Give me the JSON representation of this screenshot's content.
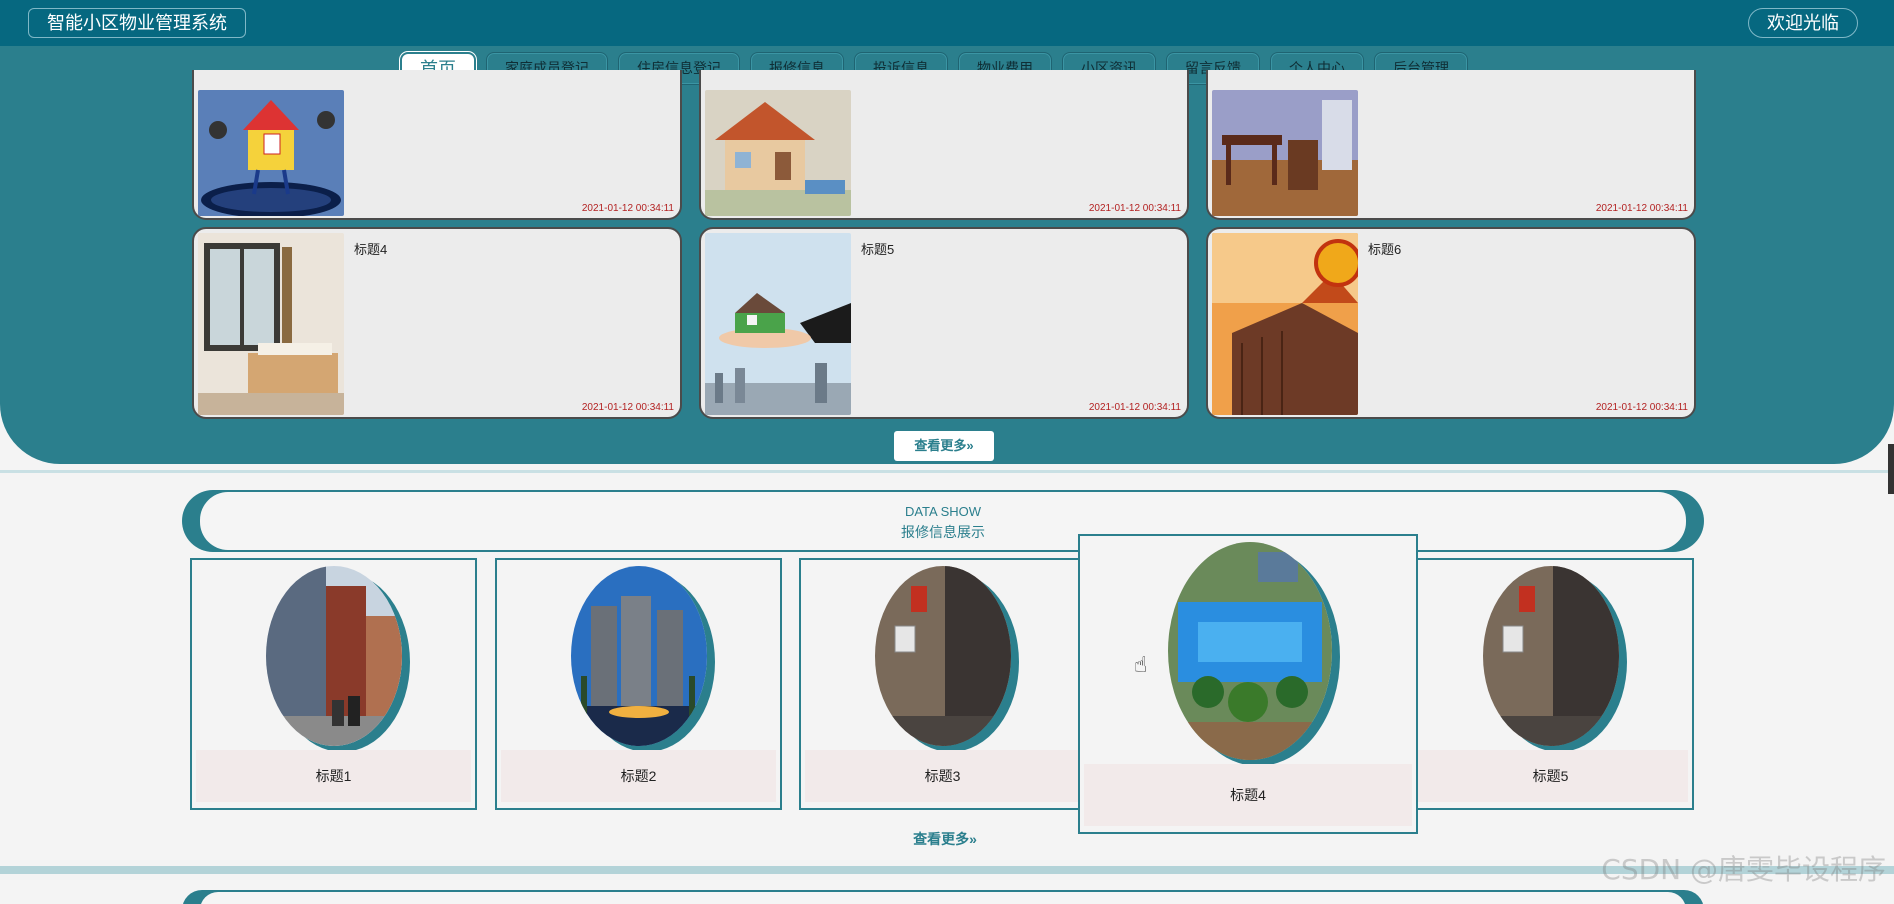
{
  "header": {
    "title": "智能小区物业管理系统",
    "welcome": "欢迎光临"
  },
  "nav": {
    "items": [
      {
        "label": "首页",
        "active": true
      },
      {
        "label": "家庭成员登记"
      },
      {
        "label": "住房信息登记"
      },
      {
        "label": "报修信息"
      },
      {
        "label": "投诉信息"
      },
      {
        "label": "物业费用"
      },
      {
        "label": "小区资讯"
      },
      {
        "label": "留言反馈"
      },
      {
        "label": "个人中心"
      },
      {
        "label": "后台管理"
      }
    ]
  },
  "news": {
    "cards": [
      {
        "title": "",
        "date": "2021-01-12 00:34:11",
        "image": "cartoon-house"
      },
      {
        "title": "",
        "date": "2021-01-12 00:34:11",
        "image": "model-house"
      },
      {
        "title": "",
        "date": "2021-01-12 00:34:11",
        "image": "dining-room"
      },
      {
        "title": "标题4",
        "date": "2021-01-12 00:34:11",
        "image": "bedroom"
      },
      {
        "title": "标题5",
        "date": "2021-01-12 00:34:11",
        "image": "house-in-hands"
      },
      {
        "title": "标题6",
        "date": "2021-01-12 00:34:11",
        "image": "box-house"
      }
    ],
    "more_label": "查看更多»"
  },
  "data_show": {
    "en_title": "DATA SHOW",
    "cn_title": "报修信息展示",
    "items": [
      {
        "title": "标题1",
        "image": "apartment-street"
      },
      {
        "title": "标题2",
        "image": "city-towers"
      },
      {
        "title": "标题3",
        "image": "elevator"
      },
      {
        "title": "标题4",
        "image": "pool-garden"
      },
      {
        "title": "标题5",
        "image": "elevator"
      }
    ],
    "more_label": "查看更多»"
  },
  "watermark": "CSDN @唐雯毕设程序",
  "colors": {
    "teal": "#2b7f8d",
    "header": "#066880",
    "date": "#b32222"
  }
}
